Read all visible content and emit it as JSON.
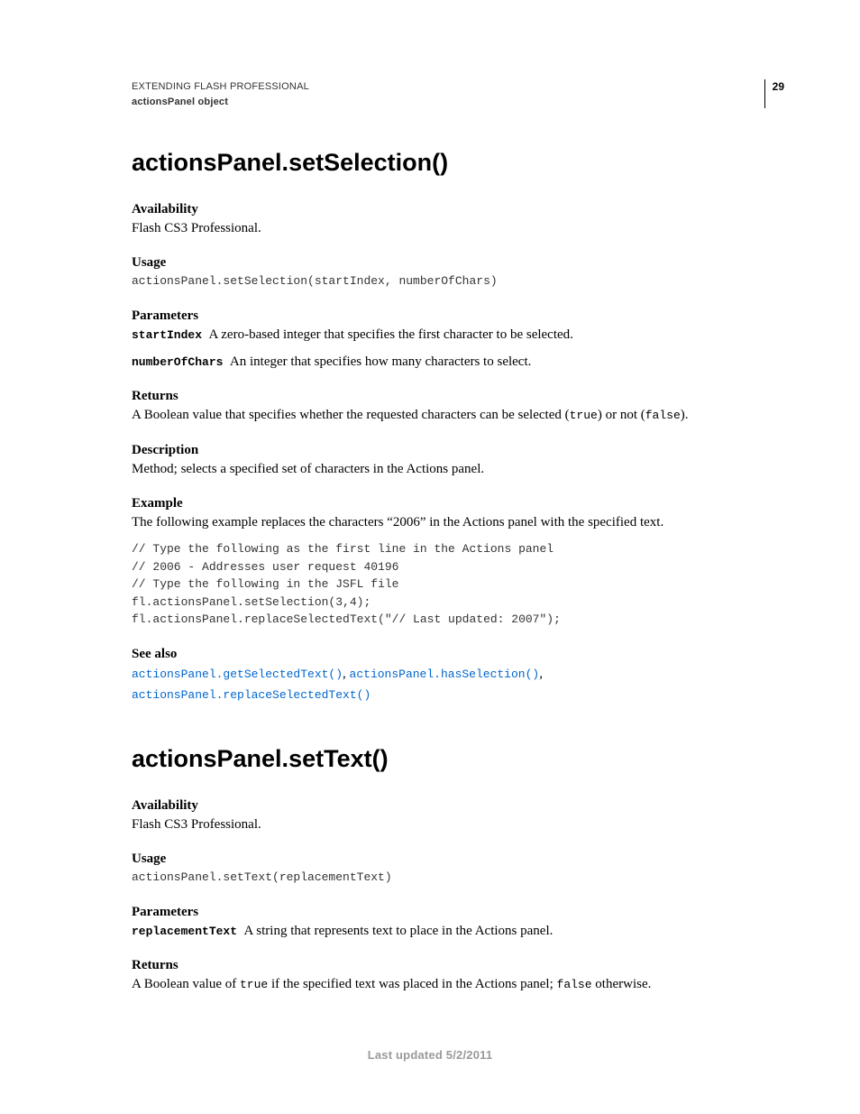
{
  "header": {
    "line1": "EXTENDING FLASH PROFESSIONAL",
    "line2": "actionsPanel object",
    "page_number": "29"
  },
  "sections": [
    {
      "title": "actionsPanel.setSelection()",
      "availability_label": "Availability",
      "availability_text": "Flash CS3 Professional.",
      "usage_label": "Usage",
      "usage_code": "actionsPanel.setSelection(startIndex, numberOfChars)",
      "parameters_label": "Parameters",
      "parameters": [
        {
          "name": "startIndex",
          "desc": "A zero-based integer that specifies the first character to be selected."
        },
        {
          "name": "numberOfChars",
          "desc": "An integer that specifies how many characters to select."
        }
      ],
      "returns_label": "Returns",
      "returns_pre": "A Boolean value that specifies whether the requested characters can be selected (",
      "returns_code1": "true",
      "returns_mid": ") or not (",
      "returns_code2": "false",
      "returns_post": ").",
      "description_label": "Description",
      "description_text": "Method; selects a specified set of characters in the Actions panel.",
      "example_label": "Example",
      "example_intro": "The following example replaces the characters “2006” in the Actions panel with the specified text.",
      "example_code": "// Type the following as the first line in the Actions panel\n// 2006 - Addresses user request 40196\n// Type the following in the JSFL file\nfl.actionsPanel.setSelection(3,4);\nfl.actionsPanel.replaceSelectedText(\"// Last updated: 2007\");",
      "see_also_label": "See also",
      "see_also_links": [
        "actionsPanel.getSelectedText()",
        "actionsPanel.hasSelection()",
        "actionsPanel.replaceSelectedText()"
      ]
    },
    {
      "title": "actionsPanel.setText()",
      "availability_label": "Availability",
      "availability_text": "Flash CS3 Professional.",
      "usage_label": "Usage",
      "usage_code": "actionsPanel.setText(replacementText)",
      "parameters_label": "Parameters",
      "parameters": [
        {
          "name": "replacementText",
          "desc": "A string that represents text to place in the Actions panel."
        }
      ],
      "returns_label": "Returns",
      "returns_pre": "A Boolean value of ",
      "returns_code1": "true",
      "returns_mid": " if the specified text was placed in the Actions panel; ",
      "returns_code2": "false",
      "returns_post": " otherwise."
    }
  ],
  "footer": "Last updated 5/2/2011"
}
